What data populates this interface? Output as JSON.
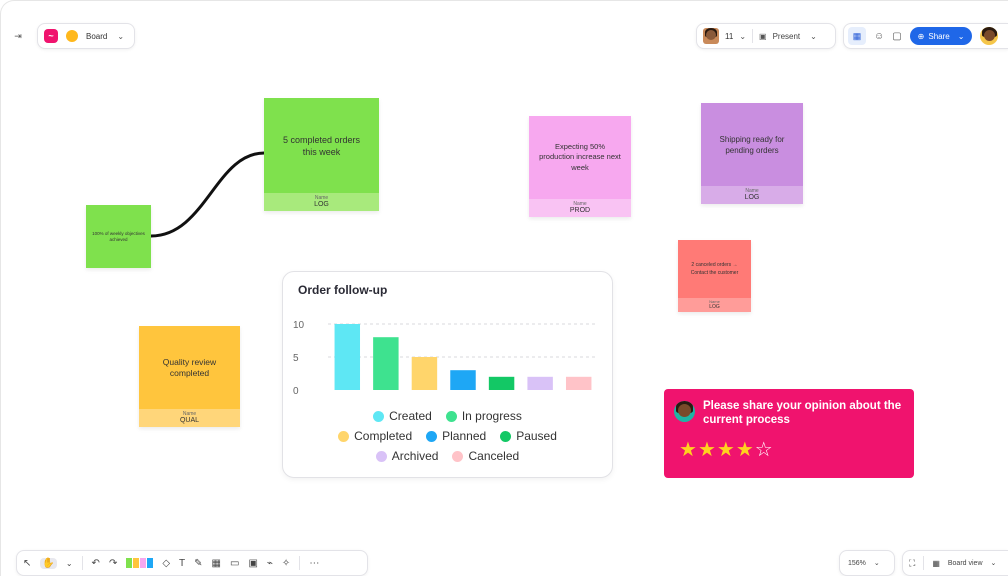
{
  "topbar": {
    "board_label": "Board",
    "participants_count": "11",
    "present_label": "Present",
    "share_label": "Share"
  },
  "stickies": {
    "completed_orders": {
      "text": "5 completed orders this week",
      "footer_label": "Name",
      "footer_value": "LOG",
      "color": "#7fe14d"
    },
    "weekly_objectives": {
      "text": "100% of weekly objectives achieved",
      "color": "#7fe14d"
    },
    "production": {
      "text": "Expecting 50% production increase next week",
      "footer_label": "Name",
      "footer_value": "PROD",
      "color": "#f7a8ef"
    },
    "shipping": {
      "text": "Shipping ready for pending orders",
      "footer_label": "Name",
      "footer_value": "LOG",
      "color": "#c98ee0"
    },
    "canceled": {
      "text": "2 canceled orders → Contact the customer",
      "footer_label": "Name",
      "footer_value": "LOG",
      "color": "#ff7a76"
    },
    "quality": {
      "text": "Quality review completed",
      "footer_label": "Name",
      "footer_value": "QUAL",
      "color": "#ffc53d"
    }
  },
  "chart_data": {
    "type": "bar",
    "title": "Order follow-up",
    "categories": [
      "Created",
      "In progress",
      "Completed",
      "Planned",
      "Paused",
      "Archived",
      "Canceled"
    ],
    "values": [
      10,
      8,
      5,
      3,
      2,
      2,
      2
    ],
    "colors": [
      "#5ee7f4",
      "#3ee28f",
      "#ffd56b",
      "#1ea7f5",
      "#13c865",
      "#d9c2f7",
      "#ffc3c8"
    ],
    "ylim": [
      0,
      10
    ],
    "yticks": [
      "10",
      "5",
      "0"
    ],
    "grid": true,
    "legend_position": "bottom"
  },
  "survey": {
    "question": "Please share your opinion about the current process",
    "rating": 4,
    "max_rating": 5
  },
  "bottombar": {
    "zoom": "156%",
    "view_label": "Board view"
  }
}
